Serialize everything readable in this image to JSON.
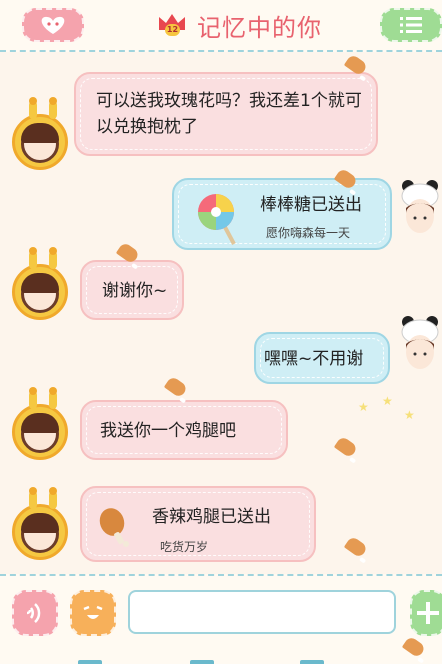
{
  "header": {
    "title": "记忆中的你",
    "level_badge": "12",
    "left_button_icon": "heart-face-icon",
    "right_button_icon": "menu-list-icon"
  },
  "messages": [
    {
      "side": "left",
      "text": "可以送我玫瑰花吗？我还差1个就可以兑换抱枕了"
    },
    {
      "side": "right",
      "type": "gift",
      "gift_icon": "lollipop-icon",
      "title": "棒棒糖已送出",
      "subtitle": "愿你嗨森每一天"
    },
    {
      "side": "left",
      "text": "谢谢你~"
    },
    {
      "side": "right",
      "text": "嘿嘿~不用谢"
    },
    {
      "side": "left",
      "text": "我送你一个鸡腿吧"
    },
    {
      "side": "left",
      "type": "gift",
      "gift_icon": "drumstick-icon",
      "title": "香辣鸡腿已送出",
      "subtitle": "吃货万岁"
    }
  ],
  "composer": {
    "voice_icon": "voice-icon",
    "emoji_icon": "emoji-face-icon",
    "input_value": "",
    "add_icon": "plus-icon"
  },
  "colors": {
    "header_title": "#e8626e",
    "left_bubble": "#fadfe0",
    "right_bubble": "#cfeef5",
    "left_button": "#f5a3ad",
    "right_button": "#9fdc94",
    "voice_button": "#f5a3ad",
    "emoji_button": "#f7b05a",
    "add_button": "#9fdc94"
  }
}
